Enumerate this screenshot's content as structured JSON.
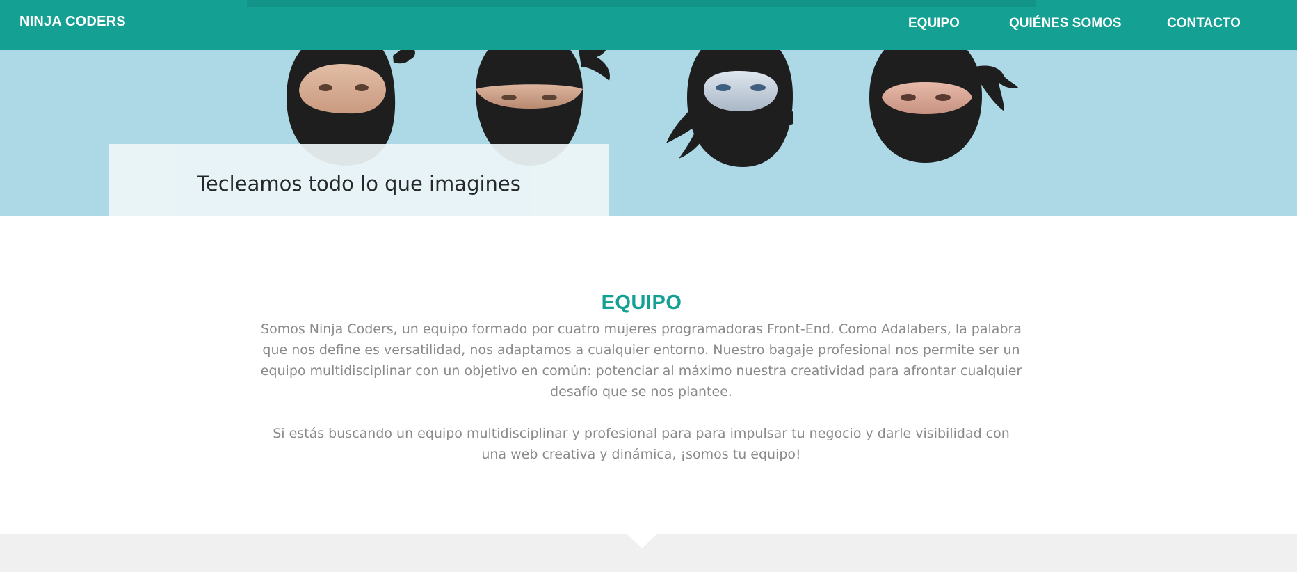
{
  "header": {
    "brand": "NINJA CODERS",
    "nav": [
      {
        "label": "EQUIPO"
      },
      {
        "label": "QUIÉNES SOMOS"
      },
      {
        "label": "CONTACTO"
      }
    ]
  },
  "hero": {
    "tagline": "Tecleamos todo lo que imagines"
  },
  "team": {
    "title": "EQUIPO",
    "paragraphs": [
      "Somos Ninja Coders, un equipo formado por cuatro mujeres programadoras Front-End. Como Adalabers, la palabra que nos define es versatilidad, nos adaptamos a cualquier entorno. Nuestro bagaje profesional nos permite ser un equipo multidisciplinar con un objetivo en común: potenciar al máximo nuestra creatividad para afrontar cualquier desafío que se nos plantee.",
      "Si estás buscando un equipo multidisciplinar y profesional para para impulsar tu negocio y darle visibilidad con una web creativa y dinámica, ¡somos tu equipo!"
    ]
  },
  "colors": {
    "header_bg": "#14a093",
    "hero_bg": "#add8e6",
    "title_color": "#14a093",
    "body_text": "#8a8a8a",
    "ninja_mask": "#1e1e1e",
    "footer_strip": "#f0f0f0"
  },
  "icons": [
    "ninja-avatar-icon",
    "ninja-avatar-icon",
    "ninja-avatar-icon",
    "ninja-avatar-icon"
  ]
}
